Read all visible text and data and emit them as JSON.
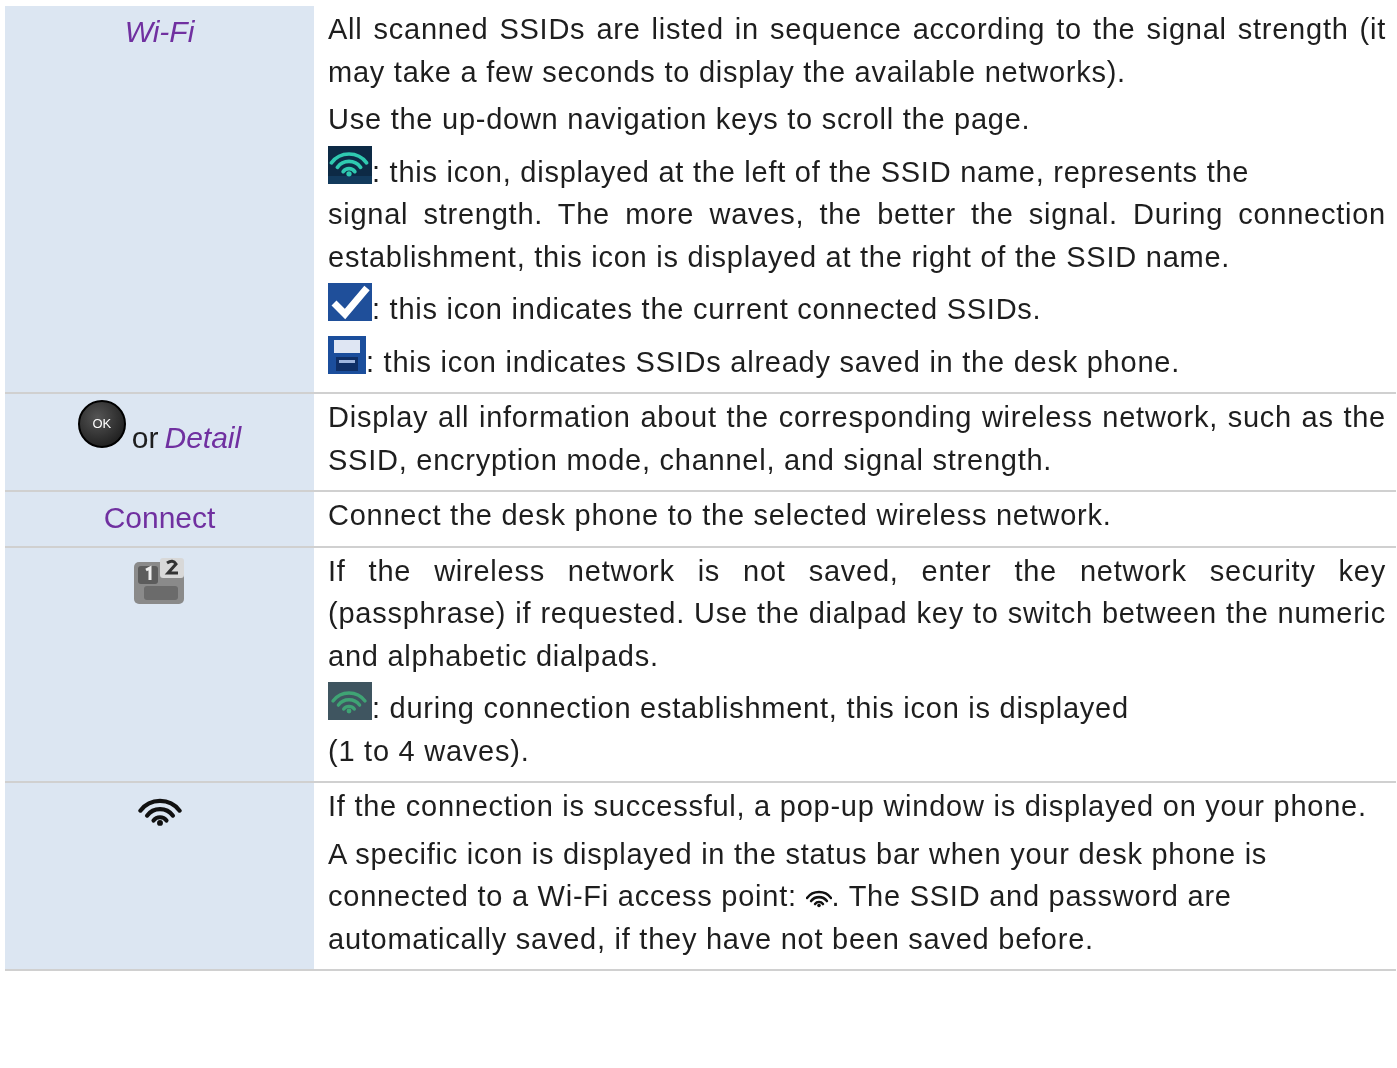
{
  "rows": [
    {
      "header": {
        "kind": "emphasis",
        "text": "Wi-Fi"
      },
      "paragraphs": [
        {
          "segments": [
            {
              "kind": "text",
              "text": "All scanned SSIDs are listed in sequence according to the signal strength (it may take a few seconds to display the available networks)."
            }
          ]
        },
        {
          "segments": [
            {
              "kind": "text",
              "text": "Use the up-down navigation keys to scroll the page."
            }
          ]
        },
        {
          "segments": [
            {
              "kind": "signal"
            },
            {
              "kind": "text",
              "text": ": this icon, displayed at the left of the SSID name, represents the"
            },
            {
              "kind": "text",
              "text": "signal strength. The more waves, the better the signal. During connection establishment, this icon is displayed at the right of the SSID name."
            }
          ]
        },
        {
          "segments": [
            {
              "kind": "check"
            },
            {
              "kind": "text",
              "text": ": this icon indicates the current connected SSIDs."
            }
          ]
        },
        {
          "segments": [
            {
              "kind": "save"
            },
            {
              "kind": "text",
              "text": ": this icon indicates SSIDs already saved in the desk phone."
            }
          ]
        }
      ]
    },
    {
      "header": {
        "kind": "okdetail",
        "ok_label": "OK",
        "prefix": "or",
        "text": "Detail"
      },
      "paragraphs": [
        {
          "segments": [
            {
              "kind": "text",
              "text": "Display all information about the corresponding wireless network, such as the SSID, encryption mode, channel, and signal strength."
            }
          ]
        }
      ]
    },
    {
      "header": {
        "kind": "label",
        "text": "Connect"
      },
      "paragraphs": [
        {
          "segments": [
            {
              "kind": "text",
              "text": "Connect the desk phone to the selected wireless network."
            }
          ]
        }
      ]
    },
    {
      "header": {
        "kind": "dialpad"
      },
      "paragraphs": [
        {
          "segments": [
            {
              "kind": "text",
              "text": "If the wireless network is not saved, enter the network security key (passphrase) if requested. Use the dialpad key to switch between the numeric and alphabetic dialpads."
            }
          ]
        },
        {
          "segments": [
            {
              "kind": "dimsignal"
            },
            {
              "kind": "text",
              "text": ": during connection establishment, this icon is displayed"
            },
            {
              "kind": "text",
              "text": "(1 to 4 waves)."
            }
          ]
        }
      ]
    },
    {
      "header": {
        "kind": "wifi"
      },
      "paragraphs": [
        {
          "segments": [
            {
              "kind": "text",
              "text": "If the connection is successful, a pop-up window is displayed on your phone."
            }
          ]
        },
        {
          "segments": [
            {
              "kind": "text",
              "text": "A specific icon is displayed in the status bar when your desk phone is"
            },
            {
              "kind": "text",
              "text": "connected to a Wi-Fi access point: "
            },
            {
              "kind": "wifi"
            },
            {
              "kind": "text",
              "text": ". The SSID and password are"
            },
            {
              "kind": "text",
              "text": "automatically saved, if they have not been saved before."
            }
          ]
        }
      ]
    }
  ]
}
